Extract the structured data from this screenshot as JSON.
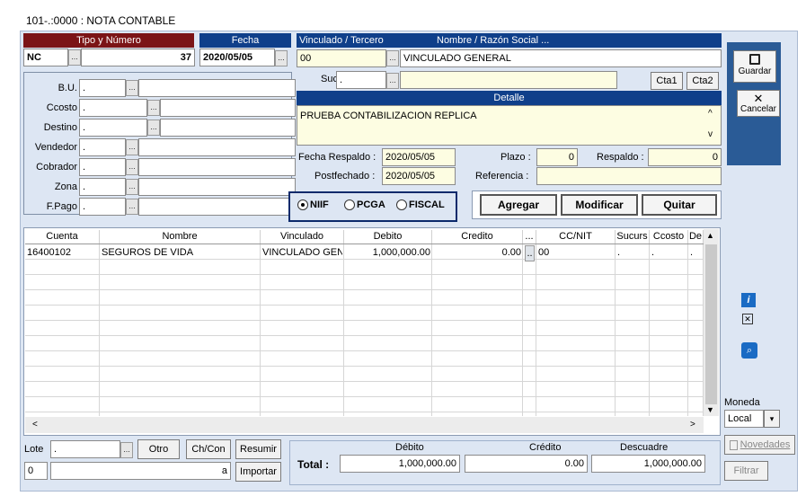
{
  "window": {
    "title": "101-.:0000 : NOTA CONTABLE"
  },
  "doc": {
    "tipo_hdr": "Tipo y Número",
    "fecha_hdr": "Fecha",
    "tipo": "NC",
    "numero": "37",
    "fecha": "2020/05/05"
  },
  "tercero": {
    "hdr_vinc": "Vinculado / Tercero",
    "hdr_nombre": "Nombre / Razón Social ...",
    "codigo": "00",
    "nombre": "VINCULADO GENERAL",
    "suc_label": "Suc.",
    "suc": ".",
    "cta1": "Cta1",
    "cta2": "Cta2"
  },
  "detalle": {
    "hdr": "Detalle",
    "texto": "PRUEBA CONTABILIZACION REPLICA"
  },
  "fields": [
    {
      "label": "B.U.",
      "value": "."
    },
    {
      "label": "Ccosto",
      "value": "."
    },
    {
      "label": "Destino",
      "value": "."
    },
    {
      "label": "Vendedor",
      "value": "."
    },
    {
      "label": "Cobrador",
      "value": "."
    },
    {
      "label": "Zona",
      "value": "."
    },
    {
      "label": "F.Pago",
      "value": "."
    }
  ],
  "fechas": {
    "respaldo_label": "Fecha Respaldo :",
    "respaldo": "2020/05/05",
    "post_label": "Postfechado :",
    "post": "2020/05/05",
    "plazo_label": "Plazo :",
    "plazo": "0",
    "resp_label": "Respaldo :",
    "resp": "0",
    "ref_label": "Referencia :",
    "ref": ""
  },
  "norma": {
    "options": [
      "NIIF",
      "PCGA",
      "FISCAL"
    ],
    "selected": "NIIF"
  },
  "actions": {
    "agregar": "Agregar",
    "modificar": "Modificar",
    "quitar": "Quitar"
  },
  "side": {
    "guardar": "Guardar",
    "cancelar": "Cancelar",
    "moneda_label": "Moneda",
    "moneda": "Local",
    "novedades": "Novedades",
    "filtrar": "Filtrar"
  },
  "grid": {
    "columns": [
      "Cuenta",
      "Nombre",
      "Vinculado",
      "Debito",
      "Credito",
      "...",
      "CC/NIT",
      "Sucurs",
      "Ccosto",
      "De"
    ],
    "rows": [
      [
        "16400102",
        "SEGUROS DE VIDA",
        "VINCULADO GENE",
        "1,000,000.00",
        "0.00",
        "..",
        "00",
        ".",
        ".",
        "."
      ]
    ]
  },
  "footer": {
    "lote_label": "Lote",
    "lote": ".",
    "lote_num": "0",
    "a_label": "a",
    "otro": "Otro",
    "chcon": "Ch/Con",
    "resumir": "Resumir",
    "importar": "Importar",
    "total_label": "Total :",
    "debito_hdr": "Débito",
    "credito_hdr": "Crédito",
    "descuadre_hdr": "Descuadre",
    "debito": "1,000,000.00",
    "credito": "0.00",
    "descuadre": "1,000,000.00"
  }
}
